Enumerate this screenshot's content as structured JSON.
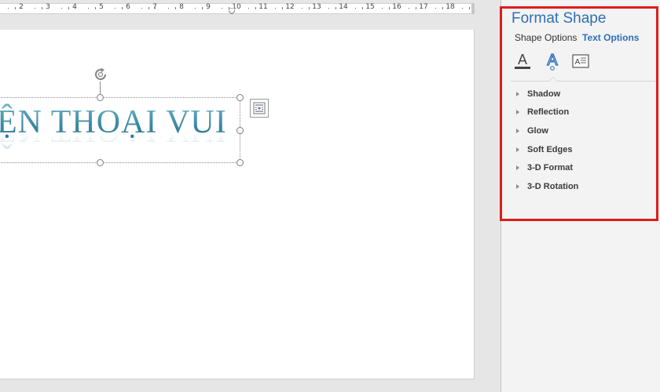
{
  "ruler": {
    "numbers": [
      "2",
      "3",
      "4",
      "5",
      "6",
      "7",
      "8",
      "9",
      "10",
      "11",
      "12",
      "13",
      "14",
      "15",
      "16",
      "17",
      "18"
    ]
  },
  "document": {
    "wordart_text": "ỆN THOẠI VUI",
    "wordart_color": "#3d8fa8"
  },
  "format_pane": {
    "title": "Format Shape",
    "tabs": [
      {
        "label": "Shape Options",
        "active": false
      },
      {
        "label": "Text Options",
        "active": true
      }
    ],
    "sub_icons": [
      "text-fill-outline-icon",
      "text-effects-icon",
      "textbox-icon"
    ],
    "sections": [
      "Shadow",
      "Reflection",
      "Glow",
      "Soft Edges",
      "3-D Format",
      "3-D Rotation"
    ],
    "accent_color": "#2e6fb5",
    "highlight_color": "#e01b1b"
  }
}
